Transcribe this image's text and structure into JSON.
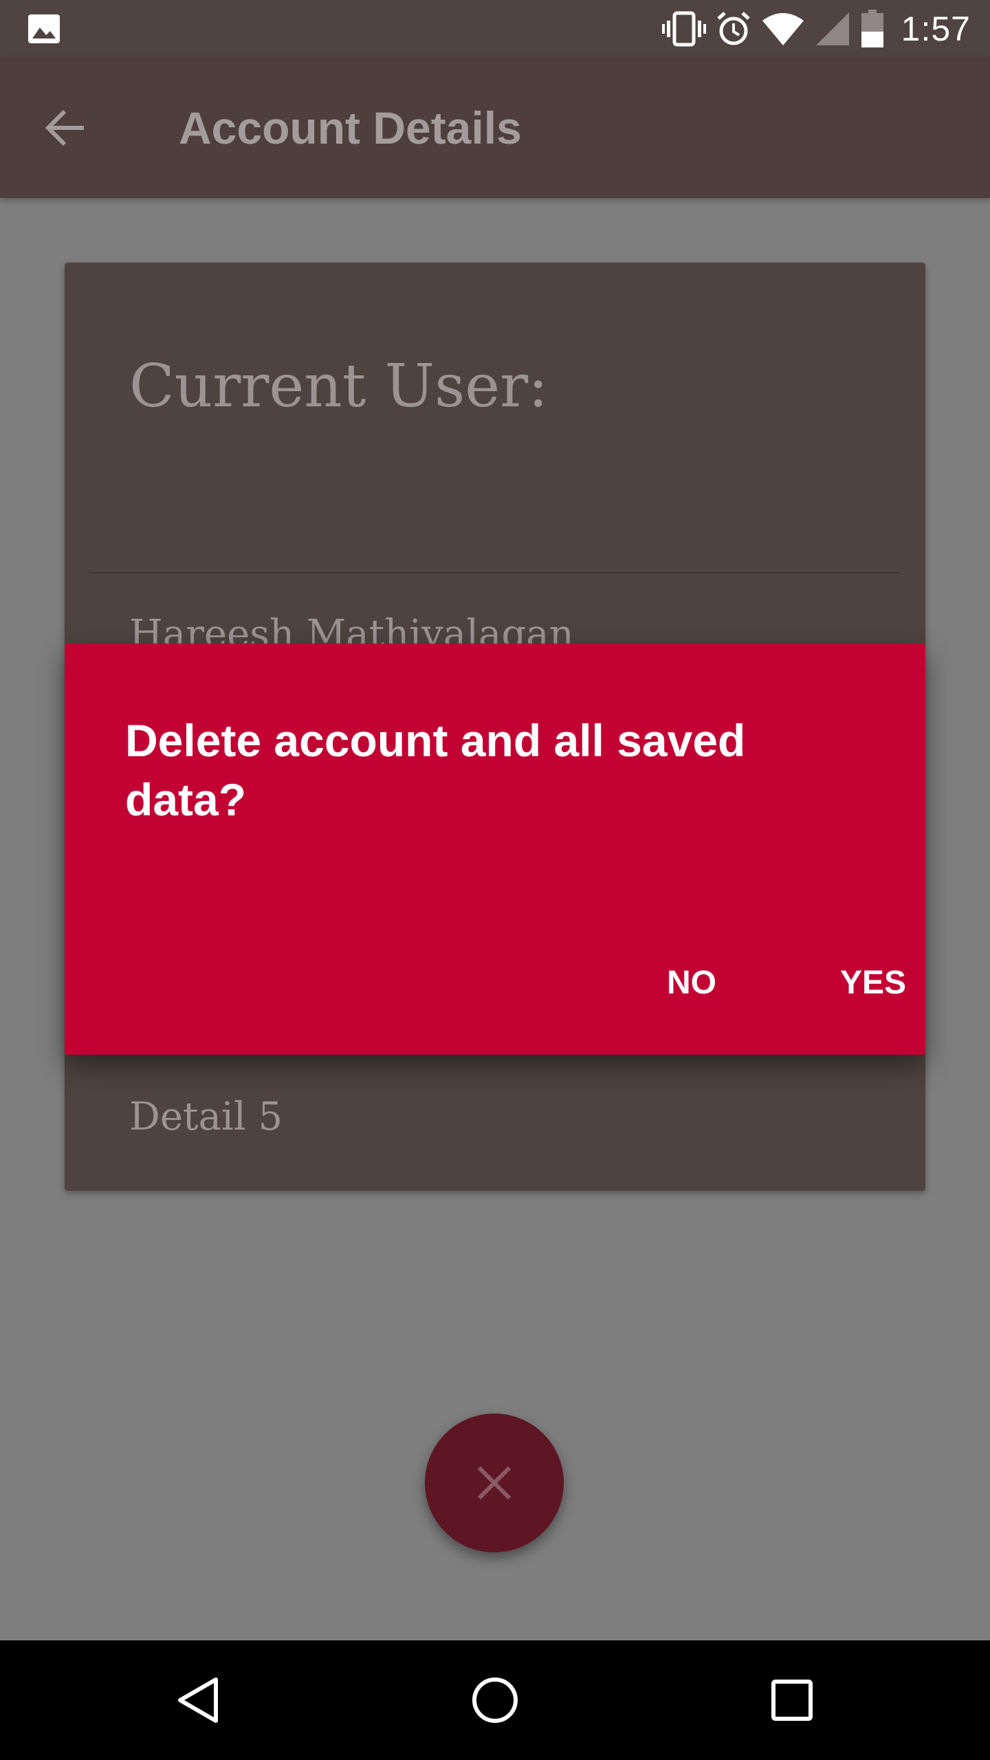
{
  "status_bar": {
    "time": "1:57",
    "icons": [
      "image-notification-icon",
      "vibrate-icon",
      "alarm-icon",
      "wifi-icon",
      "cellular-signal-icon",
      "battery-icon"
    ]
  },
  "app_bar": {
    "title": "Account Details",
    "back_icon": "arrow-back-icon"
  },
  "card": {
    "title": "Current User:",
    "user_name": "Hareesh Mathivalagan",
    "detail_5": "Detail 5"
  },
  "dialog": {
    "message": "Delete account and all saved data?",
    "no_label": "NO",
    "yes_label": "YES",
    "background_color": "#c30234"
  },
  "fab": {
    "icon": "close-icon",
    "color": "#5e1524"
  },
  "nav_bar": {
    "icons": [
      "nav-back-icon",
      "nav-home-icon",
      "nav-recents-icon"
    ]
  }
}
